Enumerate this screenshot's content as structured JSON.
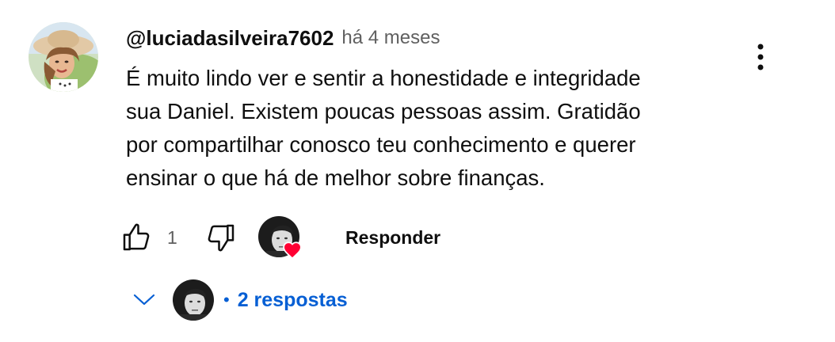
{
  "comment": {
    "author": "@luciadasilveira7602",
    "time": "há 4 meses",
    "text_lines": [
      "É muito lindo ver e sentir a honestidade e integridade",
      "sua Daniel. Existem poucas pessoas assim. Gratidão",
      "por compartilhar conosco teu conhecimento e querer",
      "ensinar o que há de melhor sobre finanças."
    ],
    "like_count": "1",
    "reply_label": "Responder",
    "replies_label": "2 respostas"
  },
  "icons": {
    "more": "more-vert-icon",
    "like": "thumb-up-icon",
    "dislike": "thumb-down-icon",
    "heart": "heart-icon",
    "chevron": "chevron-down-icon"
  },
  "colors": {
    "text": "#0f0f0f",
    "secondary": "#606060",
    "link_blue": "#065fd4",
    "heart_red": "#ff0033"
  }
}
